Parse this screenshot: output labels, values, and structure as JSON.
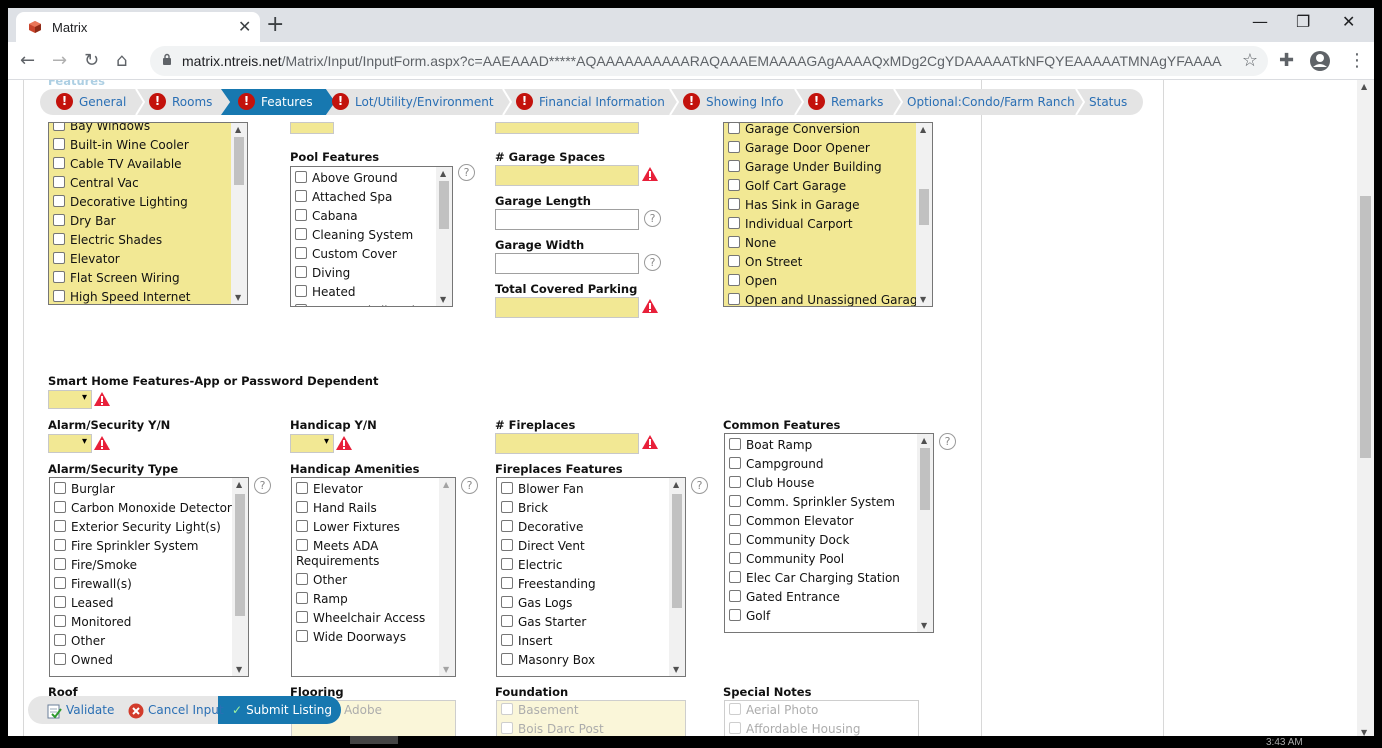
{
  "browser": {
    "tab_title": "Matrix",
    "tab_close": "✕",
    "new_tab": "+",
    "url_host": "matrix.ntreis.net",
    "url_path": "/Matrix/Input/InputForm.aspx?c=AAEAAAD*****AQAAAAAAAAAARAQAAAEMAAAAGAgAAAAQxMDg2CgYDAAAAATkNFQYEAAAAATMNAgYFAAAAATcN...",
    "clock_peek": "3:43 AM"
  },
  "steps": [
    {
      "label": "General",
      "alert": true
    },
    {
      "label": "Rooms",
      "alert": true
    },
    {
      "label": "Features",
      "alert": true,
      "active": true
    },
    {
      "label": "Lot/Utility/Environment",
      "alert": true
    },
    {
      "label": "Financial Information",
      "alert": true
    },
    {
      "label": "Showing Info",
      "alert": true
    },
    {
      "label": "Remarks",
      "alert": true
    },
    {
      "label": "Optional:Condo/Farm Ranch",
      "alert": false
    },
    {
      "label": "Status",
      "alert": false
    }
  ],
  "form": {
    "section_header": "Features",
    "interior_features": [
      "Bay Windows",
      "Built-in Wine Cooler",
      "Cable TV Available",
      "Central Vac",
      "Decorative Lighting",
      "Dry Bar",
      "Electric Shades",
      "Elevator",
      "Flat Screen Wiring",
      "High Speed Internet"
    ],
    "pool_features_label": "Pool Features",
    "pool_features": [
      "Above Ground",
      "Attached Spa",
      "Cabana",
      "Cleaning System",
      "Custom Cover",
      "Diving",
      "Heated",
      "In Ground Fiberglass"
    ],
    "garage_spaces_label": "# Garage Spaces",
    "garage_length_label": "Garage Length",
    "garage_width_label": "Garage Width",
    "total_covered_parking_label": "Total Covered Parking",
    "parking_features": [
      "Garage Conversion",
      "Garage Door Opener",
      "Garage Under Building",
      "Golf Cart Garage",
      "Has Sink in Garage",
      "Individual Carport",
      "None",
      "On Street",
      "Open",
      "Open and Unassigned Garage"
    ],
    "smart_home_label": "Smart Home Features-App or Password Dependent",
    "alarm_yn_label": "Alarm/Security Y/N",
    "handicap_yn_label": "Handicap Y/N",
    "fireplaces_label": "# Fireplaces",
    "common_features_label": "Common Features",
    "common_features": [
      "Boat Ramp",
      "Campground",
      "Club House",
      "Comm. Sprinkler System",
      "Common Elevator",
      "Community Dock",
      "Community Pool",
      "Elec Car Charging Station",
      "Gated Entrance",
      "Golf"
    ],
    "alarm_type_label": "Alarm/Security Type",
    "alarm_types": [
      "Burglar",
      "Carbon Monoxide Detector",
      "Exterior Security Light(s)",
      "Fire Sprinkler System",
      "Fire/Smoke",
      "Firewall(s)",
      "Leased",
      "Monitored",
      "Other",
      "Owned"
    ],
    "handicap_amenities_label": "Handicap Amenities",
    "handicap_amenities": [
      "Elevator",
      "Hand Rails",
      "Lower Fixtures",
      "Meets ADA Requirements",
      "Other",
      "Ramp",
      "Wheelchair Access",
      "Wide Doorways"
    ],
    "fireplaces_features_label": "Fireplaces Features",
    "fireplaces_features": [
      "Blower Fan",
      "Brick",
      "Decorative",
      "Direct Vent",
      "Electric",
      "Freestanding",
      "Gas Logs",
      "Gas Starter",
      "Insert",
      "Masonry Box"
    ],
    "roof_label": "Roof",
    "flooring_label": "Flooring",
    "foundation_label": "Foundation",
    "special_notes_label": "Special Notes",
    "flooring_peek": "Adobe",
    "foundation_peek": [
      "Basement",
      "Bois Darc Post"
    ],
    "special_notes_peek": [
      "Aerial Photo",
      "Affordable Housing"
    ],
    "help_glyph": "?"
  },
  "actions": {
    "validate": "Validate",
    "cancel": "Cancel Input",
    "submit": "Submit Listing"
  },
  "colors": {
    "active_step": "#1778b0",
    "alert_red": "#c3120c",
    "required_yellow": "#f2e894",
    "link_blue": "#2a6fb4"
  }
}
